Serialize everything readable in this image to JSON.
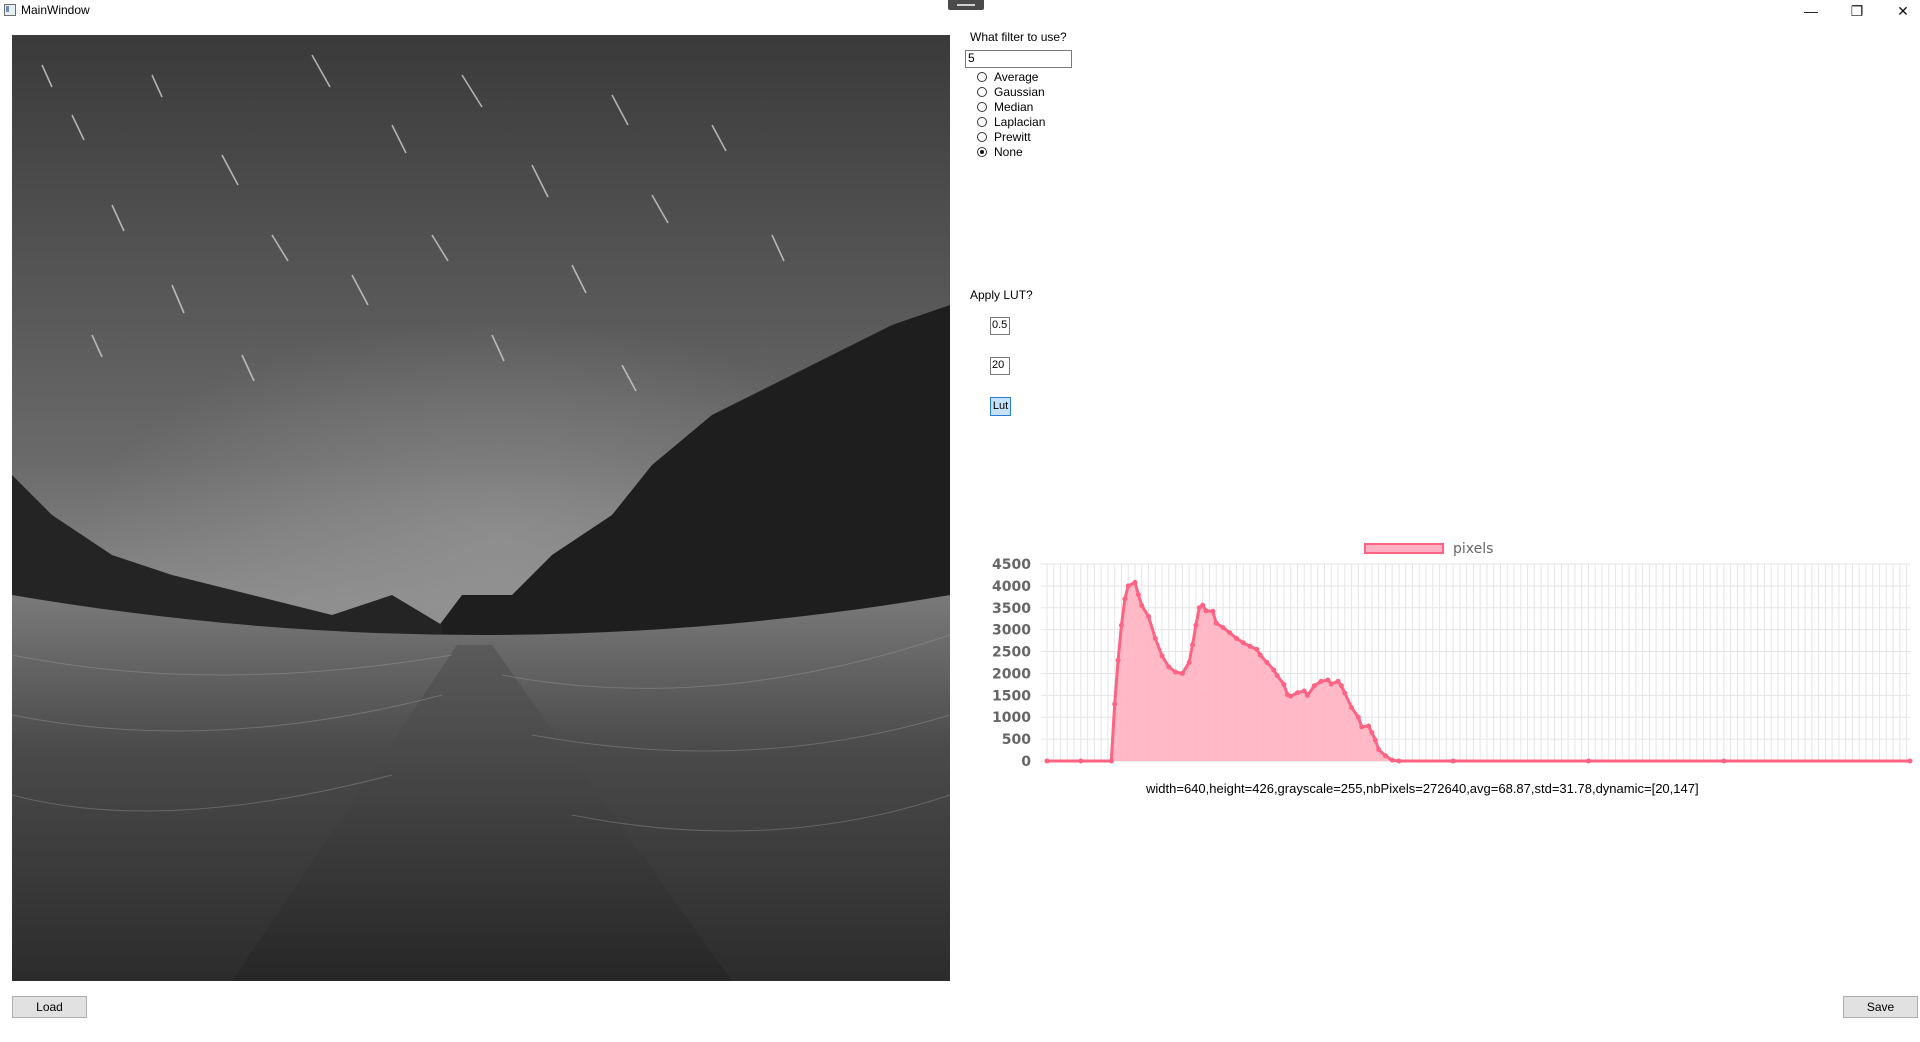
{
  "window": {
    "title": "MainWindow",
    "controls": {
      "minimize": "—",
      "restore": "❐",
      "close": "✕"
    }
  },
  "filter": {
    "question": "What filter to use?",
    "size_value": "5",
    "options": [
      "Average",
      "Gaussian",
      "Median",
      "Laplacian",
      "Prewitt",
      "None"
    ],
    "selected": "None"
  },
  "lut": {
    "question": "Apply LUT?",
    "value1": "0.5",
    "value2": "20",
    "button_label": "Lut"
  },
  "stats_text": "width=640,height=426,grayscale=255,nbPixels=272640,avg=68.87,std=31.78,dynamic=[20,147]",
  "buttons": {
    "load": "Load",
    "save": "Save"
  },
  "colors": {
    "series_fill": "#ffb1c1",
    "series_line": "#ff6384",
    "grid": "#e5e5e5"
  },
  "chart_data": {
    "type": "area",
    "legend": {
      "label": "pixels",
      "position": "top"
    },
    "ylim": [
      0,
      4500
    ],
    "yticks": [
      0,
      500,
      1000,
      1500,
      2000,
      2500,
      3000,
      3500,
      4000,
      4500
    ],
    "xlim": [
      0,
      255
    ],
    "series": [
      {
        "name": "pixels",
        "points": [
          [
            0,
            0
          ],
          [
            10,
            0
          ],
          [
            19,
            0
          ],
          [
            20,
            1300
          ],
          [
            21,
            2300
          ],
          [
            22,
            3100
          ],
          [
            23,
            3700
          ],
          [
            24,
            4000
          ],
          [
            26,
            4080
          ],
          [
            27,
            3800
          ],
          [
            28,
            3550
          ],
          [
            30,
            3300
          ],
          [
            32,
            2800
          ],
          [
            34,
            2400
          ],
          [
            36,
            2150
          ],
          [
            38,
            2030
          ],
          [
            40,
            2000
          ],
          [
            42,
            2250
          ],
          [
            43,
            2650
          ],
          [
            44,
            3100
          ],
          [
            45,
            3500
          ],
          [
            46,
            3560
          ],
          [
            47,
            3430
          ],
          [
            49,
            3420
          ],
          [
            50,
            3150
          ],
          [
            52,
            3050
          ],
          [
            54,
            2930
          ],
          [
            56,
            2800
          ],
          [
            58,
            2700
          ],
          [
            60,
            2620
          ],
          [
            62,
            2550
          ],
          [
            63,
            2420
          ],
          [
            65,
            2250
          ],
          [
            67,
            2080
          ],
          [
            68,
            1950
          ],
          [
            70,
            1750
          ],
          [
            71,
            1520
          ],
          [
            72,
            1480
          ],
          [
            74,
            1560
          ],
          [
            76,
            1600
          ],
          [
            77,
            1500
          ],
          [
            79,
            1720
          ],
          [
            81,
            1820
          ],
          [
            83,
            1850
          ],
          [
            84,
            1760
          ],
          [
            86,
            1820
          ],
          [
            87,
            1720
          ],
          [
            88,
            1550
          ],
          [
            90,
            1220
          ],
          [
            92,
            1000
          ],
          [
            93,
            780
          ],
          [
            95,
            800
          ],
          [
            96,
            650
          ],
          [
            97,
            480
          ],
          [
            98,
            260
          ],
          [
            100,
            120
          ],
          [
            102,
            20
          ],
          [
            104,
            0
          ],
          [
            120,
            0
          ],
          [
            160,
            0
          ],
          [
            200,
            0
          ],
          [
            255,
            0
          ]
        ]
      }
    ]
  }
}
